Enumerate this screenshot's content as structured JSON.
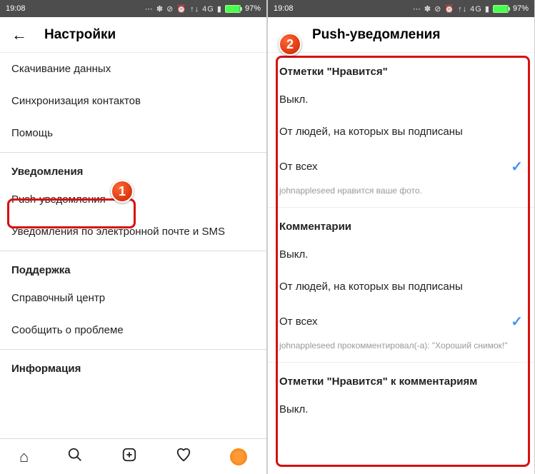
{
  "status": {
    "time": "19:08",
    "icons": "⋯ ✽ ⊘ ⏰ ↑↓ 4G ▮",
    "battery": "97%"
  },
  "left": {
    "title": "Настройки",
    "items": {
      "download": "Скачивание данных",
      "sync": "Синхронизация контактов",
      "help": "Помощь"
    },
    "sections": {
      "notifications": "Уведомления",
      "push": "Push-уведомления",
      "email_sms": "Уведомления по электронной почте и SMS",
      "support": "Поддержка",
      "help_center": "Справочный центр",
      "report": "Сообщить о проблеме",
      "info": "Информация"
    }
  },
  "right": {
    "title": "Push-уведомления",
    "groups": {
      "likes": {
        "heading": "Отметки \"Нравится\"",
        "off": "Выкл.",
        "following": "От людей, на которых вы подписаны",
        "everyone": "От всех",
        "hint": "johnappleseed нравится ваше фото."
      },
      "comments": {
        "heading": "Комментарии",
        "off": "Выкл.",
        "following": "От людей, на которых вы подписаны",
        "everyone": "От всех",
        "hint": "johnappleseed прокомментировал(-а): \"Хороший снимок!\""
      },
      "comment_likes": {
        "heading": "Отметки \"Нравится\" к комментариям",
        "off": "Выкл."
      }
    }
  },
  "badges": {
    "one": "1",
    "two": "2"
  }
}
